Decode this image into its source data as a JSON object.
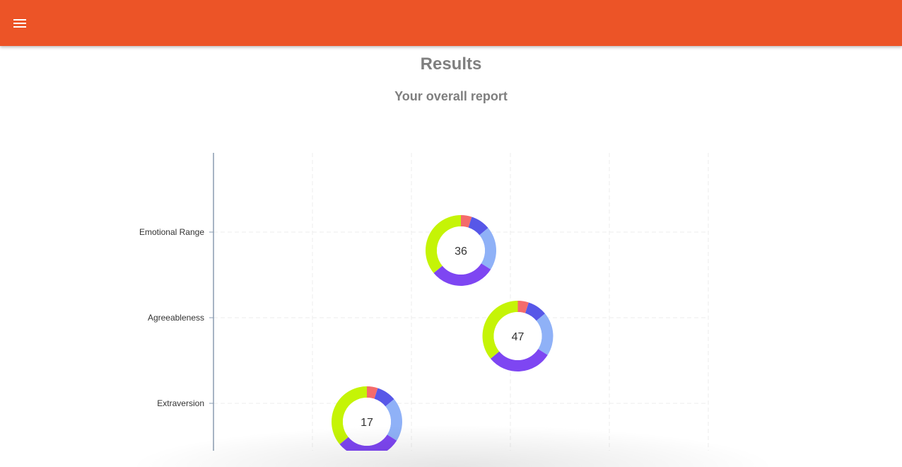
{
  "header": {
    "menu_icon": "hamburger-menu-icon",
    "color": "#ec5427"
  },
  "page": {
    "title": "Results",
    "subtitle": "Your overall report"
  },
  "chart_data": {
    "type": "scatter",
    "title": "",
    "xlabel": "",
    "ylabel": "",
    "x_range": [
      0,
      100
    ],
    "grid": true,
    "categories": [
      "Emotional Range",
      "Agreeableness",
      "Extraversion"
    ],
    "points": [
      {
        "category": "Emotional Range",
        "x": 50,
        "value": 36
      },
      {
        "category": "Agreeableness",
        "x": 61.5,
        "value": 47
      },
      {
        "category": "Extraversion",
        "x": 31,
        "value": 17
      }
    ],
    "donut_segments": [
      {
        "color": "#f46b6b",
        "share": 5
      },
      {
        "color": "#5757e8",
        "share": 9
      },
      {
        "color": "#8fb1f7",
        "share": 20
      },
      {
        "color": "#7e46f2",
        "share": 30
      },
      {
        "color": "#c5f406",
        "share": 36
      }
    ]
  }
}
